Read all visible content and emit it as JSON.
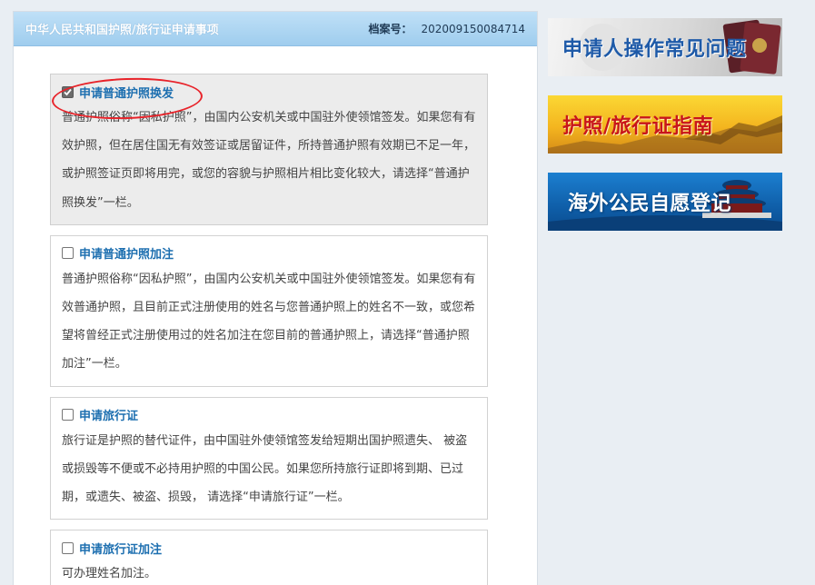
{
  "header": {
    "title": "中华人民共和国护照/旅行证申请事项",
    "file_label": "档案号：",
    "file_number": "202009150084714"
  },
  "options": [
    {
      "title": "申请普通护照换发",
      "checked": true,
      "desc": "普通护照俗称“因私护照”，由国内公安机关或中国驻外使领馆签发。如果您有有效护照，但在居住国无有效签证或居留证件，所持普通护照有效期已不足一年，或护照签证页即将用完，或您的容貌与护照相片相比变化较大，请选择“普通护照换发”一栏。"
    },
    {
      "title": "申请普通护照加注",
      "checked": false,
      "desc": "普通护照俗称“因私护照”，由国内公安机关或中国驻外使领馆签发。如果您有有效普通护照，且目前正式注册使用的姓名与您普通护照上的姓名不一致，或您希望将曾经正式注册使用过的姓名加注在您目前的普通护照上，请选择“普通护照加注”一栏。"
    },
    {
      "title": "申请旅行证",
      "checked": false,
      "desc": "旅行证是护照的替代证件，由中国驻外使领馆签发给短期出国护照遗失、 被盗或损毁等不便或不必持用护照的中国公民。如果您所持旅行证即将到期、已过期，或遗失、被盗、损毁， 请选择“申请旅行证”一栏。"
    },
    {
      "title": "申请旅行证加注",
      "checked": false,
      "desc": "可办理姓名加注。"
    }
  ],
  "sidebar": {
    "banner_faq": "申请人操作常见问题",
    "banner_guide": "护照/旅行证指南",
    "banner_register": "海外公民自愿登记"
  },
  "colors": {
    "header_bg": "#a9d3f0",
    "option_title": "#1d6fb0",
    "annotation_ring": "#e8232a"
  }
}
